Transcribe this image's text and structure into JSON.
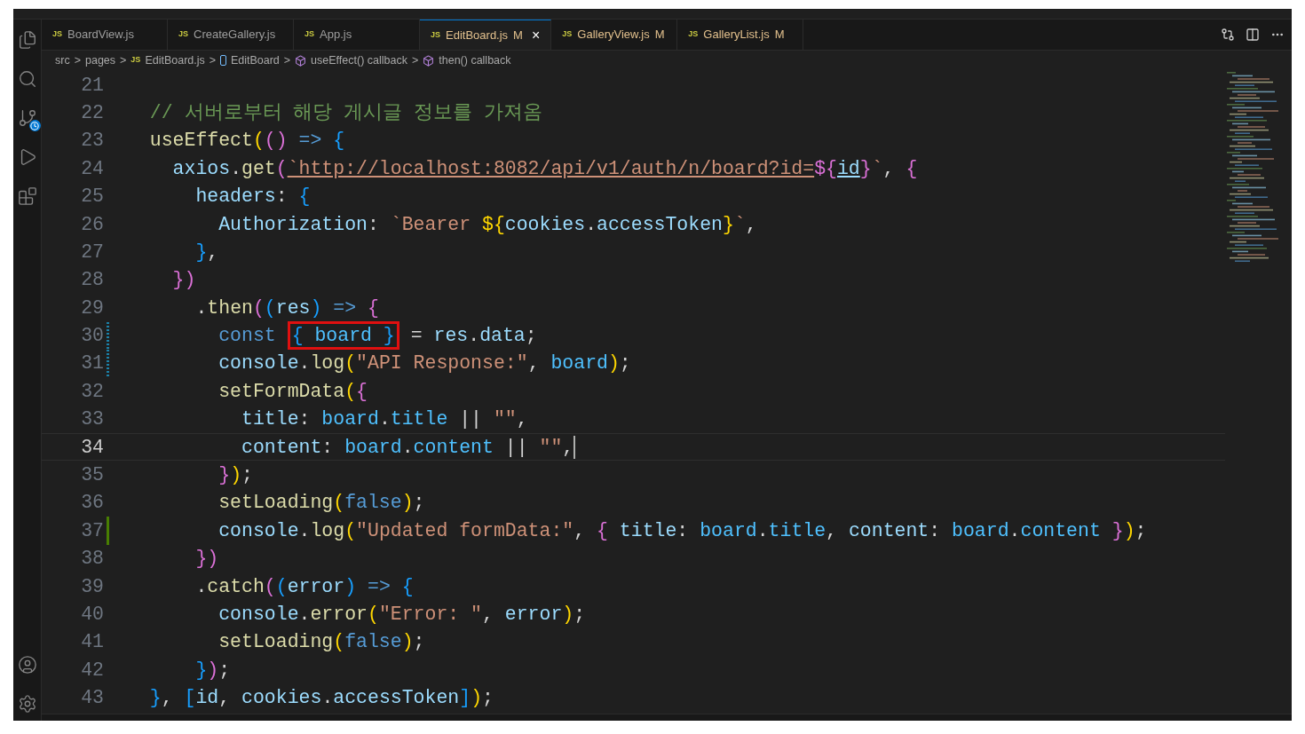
{
  "tabs": [
    {
      "label": "BoardView.js",
      "badge": "JS",
      "modified": false,
      "selected": false
    },
    {
      "label": "CreateGallery.js",
      "badge": "JS",
      "modified": false,
      "selected": false
    },
    {
      "label": "App.js",
      "badge": "JS",
      "modified": false,
      "selected": false
    },
    {
      "label": "EditBoard.js",
      "badge": "JS",
      "modified": true,
      "status": "M",
      "selected": true,
      "close": "×"
    },
    {
      "label": "GalleryView.js",
      "badge": "JS",
      "modified": true,
      "status": "M",
      "selected": false
    },
    {
      "label": "GalleryList.js",
      "badge": "JS",
      "modified": true,
      "status": "M",
      "selected": false
    }
  ],
  "breadcrumbs": [
    {
      "kind": "folder",
      "label": "src"
    },
    {
      "kind": "folder",
      "label": "pages"
    },
    {
      "kind": "file",
      "badge": "JS",
      "label": "EditBoard.js"
    },
    {
      "kind": "component",
      "label": "EditBoard"
    },
    {
      "kind": "method",
      "label": "useEffect() callback"
    },
    {
      "kind": "method",
      "label": "then() callback"
    }
  ],
  "separator": ">",
  "lines": [
    {
      "number": "21",
      "current": false,
      "modified": false,
      "added": false
    },
    {
      "number": "22",
      "current": false,
      "modified": false,
      "added": false,
      "tokens": [
        {
          "kind": "comment",
          "text": "  // 서버로부터 해당 게시글 정보를 가져옴"
        }
      ]
    },
    {
      "number": "23",
      "current": false,
      "modified": false,
      "added": false,
      "tokens": [
        {
          "kind": "func",
          "text": "  useEffect"
        },
        {
          "kind": "b1",
          "text": "("
        },
        {
          "kind": "b2",
          "text": "() "
        },
        {
          "kind": "keyword",
          "text": "=> "
        },
        {
          "kind": "b3",
          "text": "{"
        }
      ]
    },
    {
      "number": "24",
      "current": false,
      "modified": false,
      "added": false,
      "tokens": [
        {
          "kind": "var",
          "text": "    axios"
        },
        {
          "kind": "plain",
          "text": "."
        },
        {
          "kind": "func",
          "text": "get"
        },
        {
          "kind": "b2",
          "text": "("
        },
        {
          "kind": "link",
          "text": "`http://localhost:8082/api/v1/auth/n/board?id="
        },
        {
          "kind": "b2",
          "text": "${"
        },
        {
          "kind": "linkvar",
          "text": "id"
        },
        {
          "kind": "b2",
          "text": "}"
        },
        {
          "kind": "string",
          "text": "`"
        },
        {
          "kind": "plain",
          "text": ", "
        },
        {
          "kind": "b2",
          "text": "{"
        }
      ]
    },
    {
      "number": "25",
      "current": false,
      "modified": false,
      "added": false,
      "tokens": [
        {
          "kind": "var",
          "text": "      headers"
        },
        {
          "kind": "plain",
          "text": ": "
        },
        {
          "kind": "b3",
          "text": "{"
        }
      ]
    },
    {
      "number": "26",
      "current": false,
      "modified": false,
      "added": false,
      "tokens": [
        {
          "kind": "var",
          "text": "        Authorization"
        },
        {
          "kind": "plain",
          "text": ": "
        },
        {
          "kind": "string",
          "text": "`Bearer "
        },
        {
          "kind": "b1",
          "text": "${"
        },
        {
          "kind": "var",
          "text": "cookies"
        },
        {
          "kind": "plain",
          "text": "."
        },
        {
          "kind": "var",
          "text": "accessToken"
        },
        {
          "kind": "b1",
          "text": "}"
        },
        {
          "kind": "string",
          "text": "`"
        },
        {
          "kind": "plain",
          "text": ","
        }
      ]
    },
    {
      "number": "27",
      "current": false,
      "modified": false,
      "added": false,
      "tokens": [
        {
          "kind": "b3",
          "text": "      }"
        },
        {
          "kind": "plain",
          "text": ","
        }
      ]
    },
    {
      "number": "28",
      "current": false,
      "modified": false,
      "added": false,
      "tokens": [
        {
          "kind": "b2",
          "text": "    })"
        }
      ]
    },
    {
      "number": "29",
      "current": false,
      "modified": false,
      "added": false,
      "tokens": [
        {
          "kind": "plain",
          "text": "      ."
        },
        {
          "kind": "func",
          "text": "then"
        },
        {
          "kind": "b2",
          "text": "("
        },
        {
          "kind": "b3",
          "text": "("
        },
        {
          "kind": "var",
          "text": "res"
        },
        {
          "kind": "b3",
          "text": ") "
        },
        {
          "kind": "keyword",
          "text": "=> "
        },
        {
          "kind": "b2",
          "text": "{"
        }
      ]
    },
    {
      "number": "30",
      "current": false,
      "modified": true,
      "added": false,
      "tokens": [
        {
          "kind": "keyword",
          "text": "        const "
        },
        {
          "kind": "b3",
          "text": "{ ",
          "boxed": true
        },
        {
          "kind": "const",
          "text": "board",
          "boxed": true
        },
        {
          "kind": "b3",
          "text": " }",
          "boxed": true
        },
        {
          "kind": "plain",
          "text": " = "
        },
        {
          "kind": "var",
          "text": "res"
        },
        {
          "kind": "plain",
          "text": "."
        },
        {
          "kind": "var",
          "text": "data"
        },
        {
          "kind": "plain",
          "text": ";"
        }
      ]
    },
    {
      "number": "31",
      "current": false,
      "modified": true,
      "added": false,
      "tokens": [
        {
          "kind": "var",
          "text": "        console"
        },
        {
          "kind": "plain",
          "text": "."
        },
        {
          "kind": "func",
          "text": "log"
        },
        {
          "kind": "b1",
          "text": "("
        },
        {
          "kind": "string",
          "text": "\"API Response:\""
        },
        {
          "kind": "plain",
          "text": ", "
        },
        {
          "kind": "const",
          "text": "board"
        },
        {
          "kind": "b1",
          "text": ")"
        },
        {
          "kind": "plain",
          "text": ";"
        }
      ]
    },
    {
      "number": "32",
      "current": false,
      "modified": false,
      "added": false,
      "tokens": [
        {
          "kind": "func",
          "text": "        setFormData"
        },
        {
          "kind": "b1",
          "text": "("
        },
        {
          "kind": "b2",
          "text": "{"
        }
      ]
    },
    {
      "number": "33",
      "current": false,
      "modified": false,
      "added": false,
      "tokens": [
        {
          "kind": "var",
          "text": "          title"
        },
        {
          "kind": "plain",
          "text": ": "
        },
        {
          "kind": "const",
          "text": "board"
        },
        {
          "kind": "plain",
          "text": "."
        },
        {
          "kind": "const",
          "text": "title"
        },
        {
          "kind": "plain",
          "text": " || "
        },
        {
          "kind": "string",
          "text": "\"\""
        },
        {
          "kind": "plain",
          "text": ","
        }
      ]
    },
    {
      "number": "34",
      "current": true,
      "modified": false,
      "added": false,
      "tokens": [
        {
          "kind": "var",
          "text": "          content"
        },
        {
          "kind": "plain",
          "text": ": "
        },
        {
          "kind": "const",
          "text": "board"
        },
        {
          "kind": "plain",
          "text": "."
        },
        {
          "kind": "const",
          "text": "content"
        },
        {
          "kind": "plain",
          "text": " || "
        },
        {
          "kind": "string",
          "text": "\"\""
        },
        {
          "kind": "plain",
          "text": ","
        }
      ]
    },
    {
      "number": "35",
      "current": false,
      "modified": false,
      "added": false,
      "tokens": [
        {
          "kind": "b2",
          "text": "        }"
        },
        {
          "kind": "b1",
          "text": ")"
        },
        {
          "kind": "plain",
          "text": ";"
        }
      ]
    },
    {
      "number": "36",
      "current": false,
      "modified": false,
      "added": false,
      "tokens": [
        {
          "kind": "func",
          "text": "        setLoading"
        },
        {
          "kind": "b1",
          "text": "("
        },
        {
          "kind": "keyword",
          "text": "false"
        },
        {
          "kind": "b1",
          "text": ")"
        },
        {
          "kind": "plain",
          "text": ";"
        }
      ]
    },
    {
      "number": "37",
      "current": false,
      "modified": false,
      "added": true,
      "tokens": [
        {
          "kind": "var",
          "text": "        console"
        },
        {
          "kind": "plain",
          "text": "."
        },
        {
          "kind": "func",
          "text": "log"
        },
        {
          "kind": "b1",
          "text": "("
        },
        {
          "kind": "string",
          "text": "\"Updated formData:\""
        },
        {
          "kind": "plain",
          "text": ", "
        },
        {
          "kind": "b2",
          "text": "{ "
        },
        {
          "kind": "var",
          "text": "title"
        },
        {
          "kind": "plain",
          "text": ": "
        },
        {
          "kind": "const",
          "text": "board"
        },
        {
          "kind": "plain",
          "text": "."
        },
        {
          "kind": "const",
          "text": "title"
        },
        {
          "kind": "plain",
          "text": ", "
        },
        {
          "kind": "var",
          "text": "content"
        },
        {
          "kind": "plain",
          "text": ": "
        },
        {
          "kind": "const",
          "text": "board"
        },
        {
          "kind": "plain",
          "text": "."
        },
        {
          "kind": "const",
          "text": "content"
        },
        {
          "kind": "b2",
          "text": " }"
        },
        {
          "kind": "b1",
          "text": ")"
        },
        {
          "kind": "plain",
          "text": ";"
        }
      ]
    },
    {
      "number": "38",
      "current": false,
      "modified": false,
      "added": false,
      "tokens": [
        {
          "kind": "b2",
          "text": "      })"
        }
      ]
    },
    {
      "number": "39",
      "current": false,
      "modified": false,
      "added": false,
      "tokens": [
        {
          "kind": "plain",
          "text": "      ."
        },
        {
          "kind": "func",
          "text": "catch"
        },
        {
          "kind": "b2",
          "text": "("
        },
        {
          "kind": "b3",
          "text": "("
        },
        {
          "kind": "var",
          "text": "error"
        },
        {
          "kind": "b3",
          "text": ") "
        },
        {
          "kind": "keyword",
          "text": "=> "
        },
        {
          "kind": "b3",
          "text": "{"
        }
      ]
    },
    {
      "number": "40",
      "current": false,
      "modified": false,
      "added": false,
      "tokens": [
        {
          "kind": "var",
          "text": "        console"
        },
        {
          "kind": "plain",
          "text": "."
        },
        {
          "kind": "func",
          "text": "error"
        },
        {
          "kind": "b1",
          "text": "("
        },
        {
          "kind": "string",
          "text": "\"Error: \""
        },
        {
          "kind": "plain",
          "text": ", "
        },
        {
          "kind": "var",
          "text": "error"
        },
        {
          "kind": "b1",
          "text": ")"
        },
        {
          "kind": "plain",
          "text": ";"
        }
      ]
    },
    {
      "number": "41",
      "current": false,
      "modified": false,
      "added": false,
      "tokens": [
        {
          "kind": "func",
          "text": "        setLoading"
        },
        {
          "kind": "b1",
          "text": "("
        },
        {
          "kind": "keyword",
          "text": "false"
        },
        {
          "kind": "b1",
          "text": ")"
        },
        {
          "kind": "plain",
          "text": ";"
        }
      ]
    },
    {
      "number": "42",
      "current": false,
      "modified": false,
      "added": false,
      "tokens": [
        {
          "kind": "b3",
          "text": "      }"
        },
        {
          "kind": "b2",
          "text": ")"
        },
        {
          "kind": "plain",
          "text": ";"
        }
      ]
    },
    {
      "number": "43",
      "current": false,
      "modified": false,
      "added": false,
      "tokens": [
        {
          "kind": "b3",
          "text": "  }"
        },
        {
          "kind": "plain",
          "text": ", "
        },
        {
          "kind": "b3",
          "text": "["
        },
        {
          "kind": "var",
          "text": "id"
        },
        {
          "kind": "plain",
          "text": ", "
        },
        {
          "kind": "var",
          "text": "cookies"
        },
        {
          "kind": "plain",
          "text": "."
        },
        {
          "kind": "var",
          "text": "accessToken"
        },
        {
          "kind": "b3",
          "text": "]"
        },
        {
          "kind": "b1",
          "text": ")"
        },
        {
          "kind": "plain",
          "text": ";"
        }
      ]
    }
  ]
}
